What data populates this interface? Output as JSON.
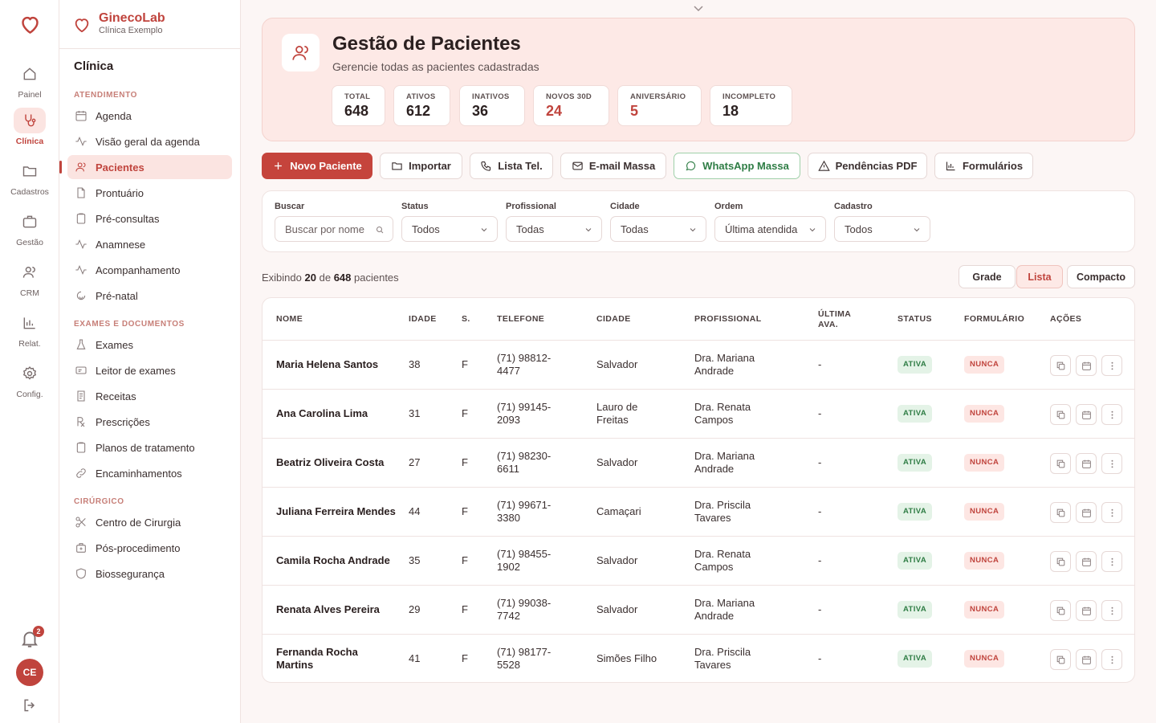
{
  "rail": {
    "items": [
      {
        "label": "Painel",
        "icon": "home-icon"
      },
      {
        "label": "Clínica",
        "icon": "stethoscope-icon"
      },
      {
        "label": "Cadastros",
        "icon": "folder-icon"
      },
      {
        "label": "Gestão",
        "icon": "briefcase-icon"
      },
      {
        "label": "CRM",
        "icon": "users-icon"
      },
      {
        "label": "Relat.",
        "icon": "bar-chart-icon"
      },
      {
        "label": "Config.",
        "icon": "gear-icon"
      }
    ],
    "active_index": 1,
    "notifications_count": "2",
    "avatar_initials": "CE"
  },
  "brand": {
    "name": "GinecoLab",
    "subtitle": "Clínica Exemplo"
  },
  "sidebar": {
    "title": "Clínica",
    "sections": [
      {
        "label": "ATENDIMENTO",
        "items": [
          {
            "label": "Agenda",
            "icon": "calendar-icon"
          },
          {
            "label": "Visão geral da agenda",
            "icon": "activity-icon"
          },
          {
            "label": "Pacientes",
            "icon": "user-icon"
          },
          {
            "label": "Prontuário",
            "icon": "file-icon"
          },
          {
            "label": "Pré-consultas",
            "icon": "clipboard-icon"
          },
          {
            "label": "Anamnese",
            "icon": "activity-icon"
          },
          {
            "label": "Acompanhamento",
            "icon": "activity-icon"
          },
          {
            "label": "Pré-natal",
            "icon": "baby-icon"
          }
        ]
      },
      {
        "label": "EXAMES E DOCUMENTOS",
        "items": [
          {
            "label": "Exames",
            "icon": "flask-icon"
          },
          {
            "label": "Leitor de exames",
            "icon": "scanner-icon"
          },
          {
            "label": "Receitas",
            "icon": "receipt-icon"
          },
          {
            "label": "Prescrições",
            "icon": "rx-icon"
          },
          {
            "label": "Planos de tratamento",
            "icon": "clipboard-icon"
          },
          {
            "label": "Encaminhamentos",
            "icon": "link-icon"
          }
        ]
      },
      {
        "label": "CIRÚRGICO",
        "items": [
          {
            "label": "Centro de Cirurgia",
            "icon": "scissors-icon"
          },
          {
            "label": "Pós-procedimento",
            "icon": "medical-kit-icon"
          },
          {
            "label": "Biossegurança",
            "icon": "shield-icon"
          }
        ]
      }
    ],
    "active_item": "Pacientes"
  },
  "header": {
    "title": "Gestão de Pacientes",
    "subtitle": "Gerencie todas as pacientes cadastradas",
    "stats": [
      {
        "label": "TOTAL",
        "value": "648",
        "highlight": false
      },
      {
        "label": "ATIVOS",
        "value": "612",
        "highlight": false
      },
      {
        "label": "INATIVOS",
        "value": "36",
        "highlight": false
      },
      {
        "label": "NOVOS 30D",
        "value": "24",
        "highlight": true
      },
      {
        "label": "ANIVERSÁRIO",
        "value": "5",
        "highlight": true
      },
      {
        "label": "INCOMPLETO",
        "value": "18",
        "highlight": false
      }
    ]
  },
  "toolbar": {
    "new_patient": "Novo Paciente",
    "import": "Importar",
    "phone_list": "Lista Tel.",
    "bulk_email": "E-mail Massa",
    "bulk_whatsapp": "WhatsApp Massa",
    "pending_pdf": "Pendências PDF",
    "forms": "Formulários"
  },
  "filters": {
    "search": {
      "label": "Buscar",
      "placeholder": "Buscar por nome"
    },
    "status": {
      "label": "Status",
      "value": "Todos"
    },
    "professional": {
      "label": "Profissional",
      "value": "Todas"
    },
    "city": {
      "label": "Cidade",
      "value": "Todas"
    },
    "order": {
      "label": "Ordem",
      "value": "Última atendida"
    },
    "registration": {
      "label": "Cadastro",
      "value": "Todos"
    }
  },
  "summary": {
    "prefix": "Exibindo",
    "shown": "20",
    "middle": "de",
    "total": "648",
    "suffix": "pacientes"
  },
  "view_modes": {
    "grid": "Grade",
    "list": "Lista",
    "compact": "Compacto",
    "active": "Lista"
  },
  "table": {
    "columns": [
      "NOME",
      "IDADE",
      "S.",
      "TELEFONE",
      "CIDADE",
      "PROFISSIONAL",
      "ÚLTIMA AVA.",
      "STATUS",
      "FORMULÁRIO",
      "AÇÕES"
    ],
    "rows": [
      {
        "name": "Maria Helena Santos",
        "age": "38",
        "sex": "F",
        "phone": "(71) 98812-4477",
        "city": "Salvador",
        "professional": "Dra. Mariana Andrade",
        "last": "-",
        "status": "ATIVA",
        "form": "NUNCA"
      },
      {
        "name": "Ana Carolina Lima",
        "age": "31",
        "sex": "F",
        "phone": "(71) 99145-2093",
        "city": "Lauro de Freitas",
        "professional": "Dra. Renata Campos",
        "last": "-",
        "status": "ATIVA",
        "form": "NUNCA"
      },
      {
        "name": "Beatriz Oliveira Costa",
        "age": "27",
        "sex": "F",
        "phone": "(71) 98230-6611",
        "city": "Salvador",
        "professional": "Dra. Mariana Andrade",
        "last": "-",
        "status": "ATIVA",
        "form": "NUNCA"
      },
      {
        "name": "Juliana Ferreira Mendes",
        "age": "44",
        "sex": "F",
        "phone": "(71) 99671-3380",
        "city": "Camaçari",
        "professional": "Dra. Priscila Tavares",
        "last": "-",
        "status": "ATIVA",
        "form": "NUNCA"
      },
      {
        "name": "Camila Rocha Andrade",
        "age": "35",
        "sex": "F",
        "phone": "(71) 98455-1902",
        "city": "Salvador",
        "professional": "Dra. Renata Campos",
        "last": "-",
        "status": "ATIVA",
        "form": "NUNCA"
      },
      {
        "name": "Renata Alves Pereira",
        "age": "29",
        "sex": "F",
        "phone": "(71) 99038-7742",
        "city": "Salvador",
        "professional": "Dra. Mariana Andrade",
        "last": "-",
        "status": "ATIVA",
        "form": "NUNCA"
      },
      {
        "name": "Fernanda Rocha Martins",
        "age": "41",
        "sex": "F",
        "phone": "(71) 98177-5528",
        "city": "Simões Filho",
        "professional": "Dra. Priscila Tavares",
        "last": "-",
        "status": "ATIVA",
        "form": "NUNCA"
      }
    ]
  },
  "colors": {
    "accent": "#c0443d",
    "accent_soft": "#fde9e6",
    "success": "#2f7d45",
    "success_soft": "#e4f3e7"
  }
}
